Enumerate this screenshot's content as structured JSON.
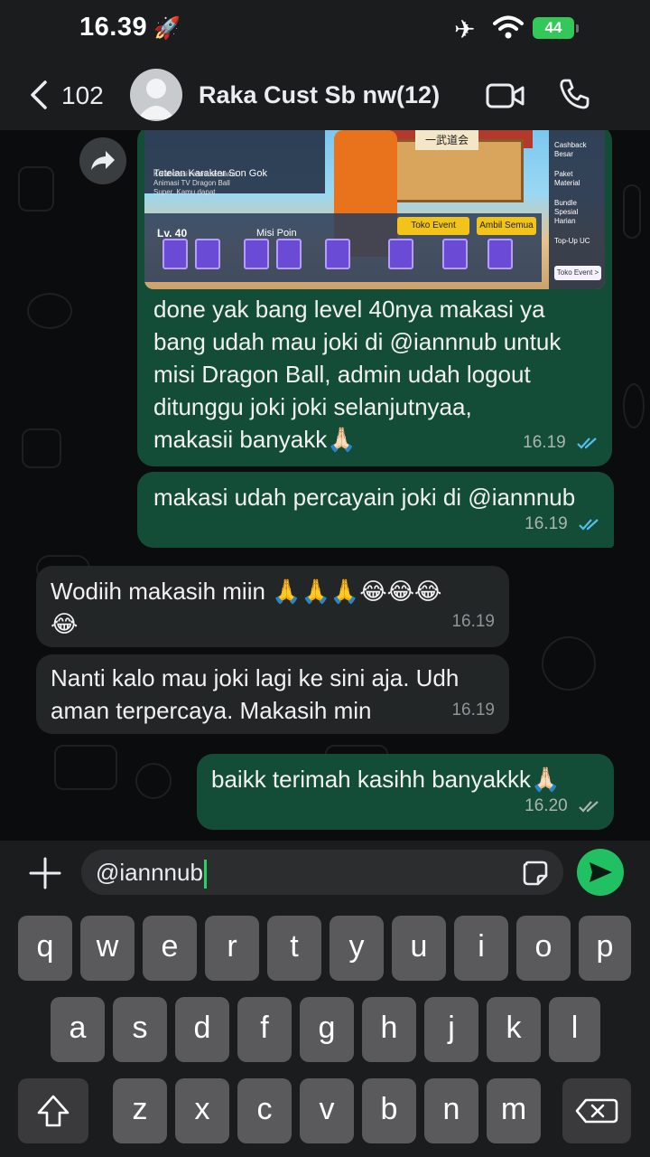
{
  "status_bar": {
    "time": "16.39",
    "battery": "44"
  },
  "header": {
    "back_count": "102",
    "title": "Raka Cust Sb nw(12)"
  },
  "game_screenshot": {
    "panel_title": "Tetelan Karakter Son Gok",
    "panel_sub": "Kolaborasi resmi bersama Animasi TV Dragon Ball Super. Kamu dapat",
    "sign": "一武道会",
    "level": "Lv. 40",
    "misi": "Misi Poin",
    "toko_event_btn": "Toko Event",
    "ambil_btn": "Ambil Semua",
    "side_items": [
      "Cashback Besar",
      "Paket Material",
      "Bundle Spesial Harian",
      "Top-Up UC"
    ],
    "toko_link": "Toko Event >"
  },
  "messages": [
    {
      "direction": "out",
      "lines": [
        "done yak bang level 40nya makasi ya",
        "bang udah mau joki di @iannnub untuk",
        "misi Dragon Ball, admin udah logout",
        "ditunggu joki joki selanjutnyaa,",
        "makasii banyakk🙏🏻"
      ],
      "time": "16.19",
      "status": "read"
    },
    {
      "direction": "out",
      "lines": [
        "makasi udah percayain joki di @iannnub"
      ],
      "time": "16.19",
      "status": "read"
    },
    {
      "direction": "in",
      "lines": [
        "Wodiih makasih miin 🙏🙏🙏😂😂😂",
        "😂"
      ],
      "time": "16.19"
    },
    {
      "direction": "in",
      "lines": [
        "Nanti kalo mau joki lagi ke sini aja. Udh",
        "aman terpercaya. Makasih min"
      ],
      "time": "16.19"
    },
    {
      "direction": "out",
      "lines": [
        "baikk terimah kasihh banyakkk🙏🏻"
      ],
      "time": "16.20",
      "status": "delivered"
    }
  ],
  "composer": {
    "value": "@iannnub"
  },
  "keyboard": {
    "row1": [
      "q",
      "w",
      "e",
      "r",
      "t",
      "y",
      "u",
      "i",
      "o",
      "p"
    ],
    "row2": [
      "a",
      "s",
      "d",
      "f",
      "g",
      "h",
      "j",
      "k",
      "l"
    ],
    "row3": [
      "z",
      "x",
      "c",
      "v",
      "b",
      "n",
      "m"
    ]
  },
  "colors": {
    "outgoing_bubble": "#144d37",
    "incoming_bubble": "#232627",
    "read_ticks": "#53bdeb",
    "send_button": "#21c063"
  }
}
